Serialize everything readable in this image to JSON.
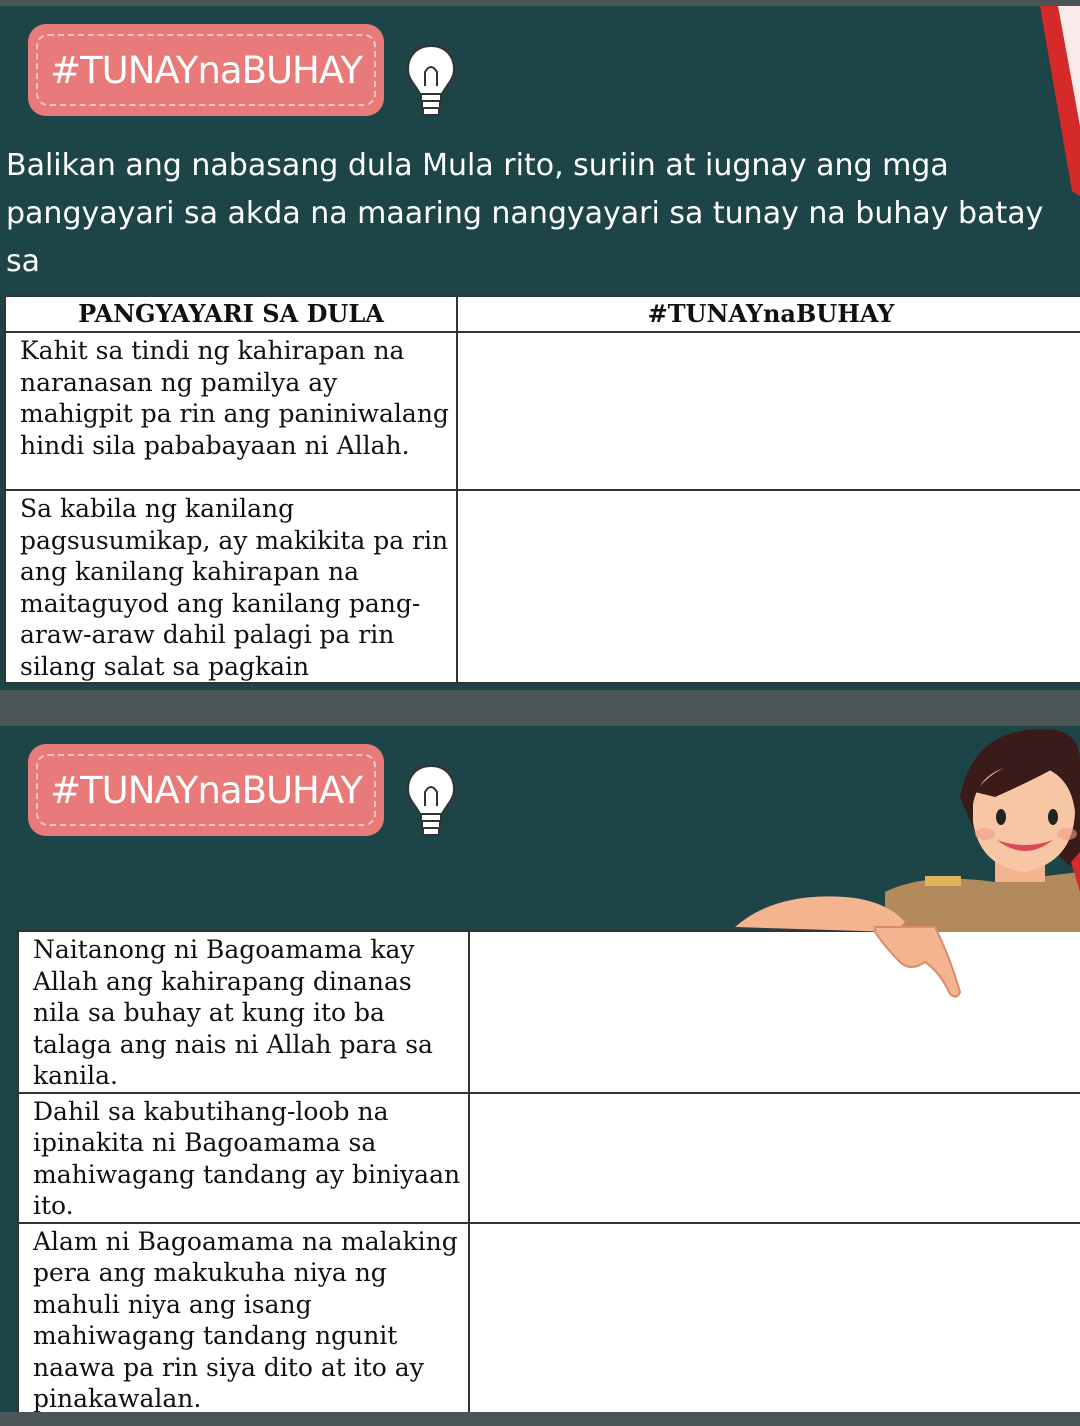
{
  "badge_top": {
    "label": "#TUNAYnaBUHAY"
  },
  "instructions": "Balikan ang nabasang dula Mula rito, suriin at iugnay ang mga\npangyayari sa akda na maaring nangyayari sa tunay na buhay batay sa\niyong karanasan, naranasan o nasaksihan.",
  "table1": {
    "headers": [
      "PANGYAYARI SA DULA",
      "#TUNAYnaBUHAY"
    ],
    "rows": [
      {
        "event": "Kahit sa tindi ng kahirapan na naranasan ng pamilya ay mahigpit pa rin ang paniniwalang hindi sila pababayaan ni Allah.",
        "answer": ""
      },
      {
        "event": "Sa kabila ng kanilang pagsusumikap, ay makikita pa rin ang kanilang kahirapan na maitaguyod ang kanilang pang-araw-araw dahil palagi pa rin silang salat sa pagkain",
        "answer": ""
      }
    ]
  },
  "badge_bottom": {
    "label": "#TUNAYnaBUHAY"
  },
  "table2": {
    "rows": [
      {
        "event": "Naitanong ni Bagoamama kay Allah ang kahirapang dinanas nila sa buhay at kung ito ba talaga ang nais ni Allah para sa kanila.",
        "answer": ""
      },
      {
        "event": "Dahil sa kabutihang-loob na ipinakita ni Bagoamama sa mahiwagang tandang ay biniyaan ito.",
        "answer": ""
      },
      {
        "event": "Alam ni Bagoamama na malaking pera ang makukuha niya ng mahuli niya ang isang mahiwagang tandang ngunit naawa pa rin siya dito at ito ay pinakawalan.",
        "answer": ""
      }
    ]
  },
  "colors": {
    "board": "#1d4446",
    "badge": "#e97a7a",
    "gap": "#4c5658"
  },
  "icons": [
    "lightbulb-icon",
    "teacher-illustration"
  ]
}
